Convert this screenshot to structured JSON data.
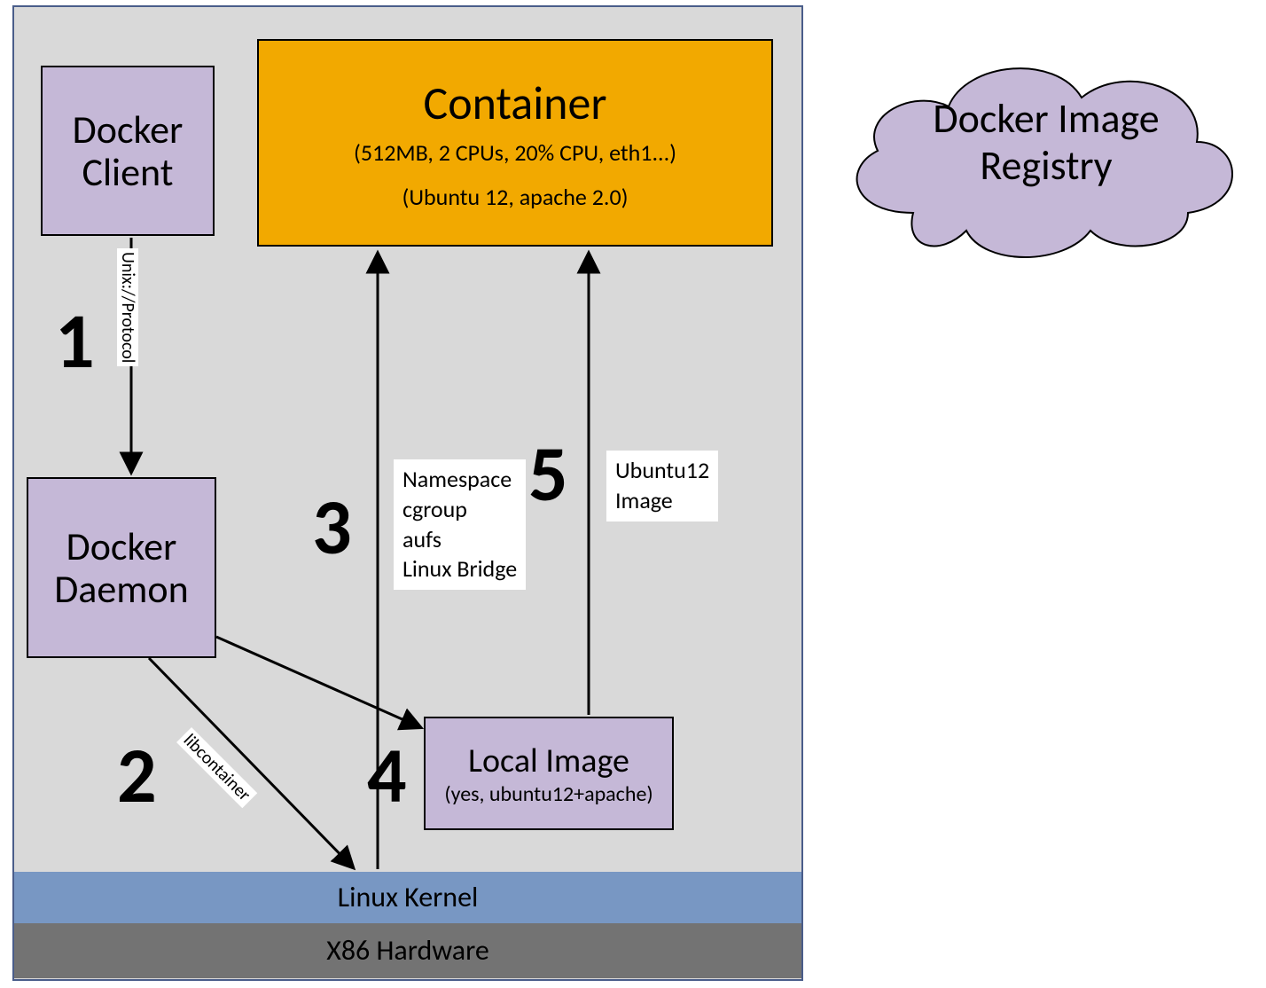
{
  "hostBox": {
    "dockerClient": "Docker\nClient",
    "dockerDaemon": "Docker\nDaemon",
    "container": {
      "title": "Container",
      "specs": "(512MB, 2 CPUs, 20% CPU, eth1...)",
      "image": "(Ubuntu 12, apache 2.0)"
    },
    "localImage": {
      "title": "Local Image",
      "sub": "(yes, ubuntu12+apache)"
    },
    "kernel": "Linux Kernel",
    "hardware": "X86 Hardware"
  },
  "registryCloud": "Docker Image\nRegistry",
  "steps": {
    "s1": "1",
    "s2": "2",
    "s3": "3",
    "s4": "4",
    "s5": "5"
  },
  "edgeLabels": {
    "unixProtocol": "Unix://Protocol",
    "libcontainer": "libcontainer",
    "note3": "Namespace\ncgroup\naufs\nLinux Bridge",
    "note5": "Ubuntu12\nImage"
  },
  "colors": {
    "purple": "#c5b8d7",
    "orange": "#f2a900",
    "blue": "#7897c3",
    "grey": "#737373",
    "lightgrey": "#d9d9d9"
  }
}
